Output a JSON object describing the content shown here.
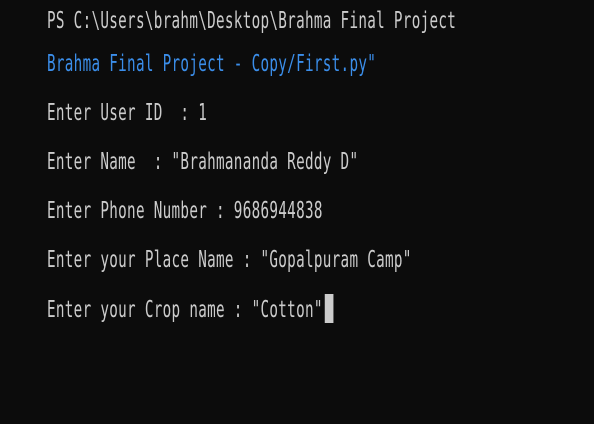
{
  "terminal": {
    "lines": [
      "PS C:\\Users\\brahm\\Desktop\\Brahma Final Project",
      "Brahma Final Project - Copy/First.py\"",
      "Enter User ID  : 1",
      "Enter Name  : \"Brahmananda Reddy D\"",
      "Enter Phone Number : 9686944838",
      "Enter your Place Name : \"Gopalpuram Camp\"",
      "Enter your Crop name : \"Cotton\""
    ]
  },
  "colors": {
    "background": "#0c0c0c",
    "text": "#cccccc",
    "path_accent": "#3b8eea",
    "cursor": "#cccccc"
  }
}
